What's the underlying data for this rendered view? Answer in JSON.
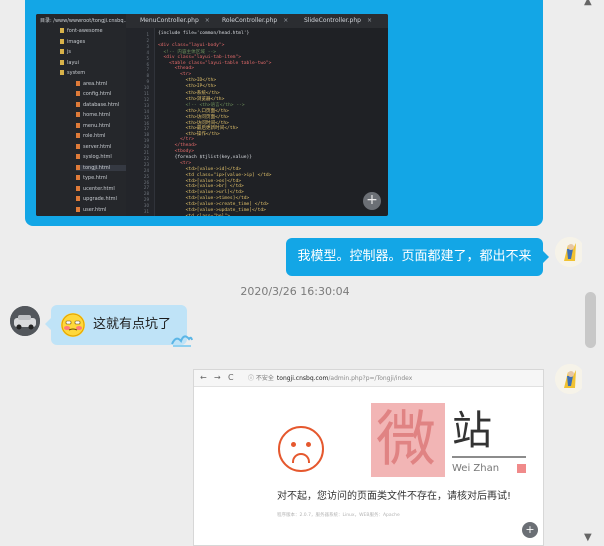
{
  "ide": {
    "path_label": "目录: /www/wwwroot/tongji.cnsbq...",
    "folders": [
      {
        "label": "font-awesome",
        "open": false
      },
      {
        "label": "images",
        "open": false
      },
      {
        "label": "js",
        "open": false
      },
      {
        "label": "layui",
        "open": false
      },
      {
        "label": "system",
        "open": true
      }
    ],
    "files": [
      "area.html",
      "config.html",
      "database.html",
      "home.html",
      "menu.html",
      "role.html",
      "server.html",
      "syslog.html",
      "tongji.html",
      "type.html",
      "ucenter.html",
      "upgrade.html",
      "user.html"
    ],
    "selected_file": "tongji.html",
    "tabs": [
      "MenuController.php",
      "RoleController.php",
      "SlideController.php"
    ],
    "tab_close": "×",
    "line_numbers": [
      "1",
      "2",
      "3",
      "4",
      "5",
      "6",
      "7",
      "8",
      "9",
      "10",
      "11",
      "12",
      "13",
      "14",
      "15",
      "16",
      "17",
      "18",
      "19",
      "20",
      "21",
      "22",
      "23",
      "24",
      "25",
      "26",
      "27",
      "28",
      "29",
      "30",
      "31"
    ],
    "code_lines": [
      "{include file='common/head.html'}",
      "",
      "<div class=\"layui-body\">",
      "  <!-- 内容主体区域 -->",
      "  <div class=\"layui-tab-item\">",
      "    <table class=\"layui-table table-two\">",
      "      <thead>",
      "        <tr>",
      "          <th>ID</th>",
      "          <th>IP</th>",
      "          <th>系统</th>",
      "          <th>浏览器</th>",
      "          <!-- <th>语言</th> -->",
      "          <th>入口页面</th>",
      "          <th>访问页面</th>",
      "          <th>访问时间</th>",
      "          <th>最后更新时间</th>",
      "          <th>操作</th>",
      "        </tr>",
      "      </thead>",
      "      <tbody>",
      "      {foreach $tjlist(key,value)}",
      "        <tr>",
      "          <td>[value->id]</td>",
      "          <td class=\"ip>[value->ip] </td>",
      "          <td>[value->os]</td>",
      "          <td>[value->br] </td>",
      "          <td>[value->url]</td>",
      "          <td>[value->times]</td>",
      "          <td>[value->create_time] </td>",
      "          <td>[value->update_time]</td>"
    ],
    "code_line_32": "          <td class=\"hel\">",
    "plus_label": "+"
  },
  "messages": {
    "outgoing_text": "我模型。控制器。页面都建了，都出不来",
    "timestamp": "2020/3/26 16:30:04",
    "incoming_text": "这就有点坑了"
  },
  "browser": {
    "nav_back": "←",
    "nav_forward": "→",
    "nav_reload": "C",
    "security_label": "ⓘ 不安全",
    "url_host": "tongji.cnsbq.com",
    "url_rest": "/admin.php?p=/Tongji/index",
    "error_text": "对不起，您访问的页面类文件不存在，请核对后再试!",
    "footer_text": "程序版本：2.0.7，服务器系统：Linux，WEB服务：Apache",
    "watermark_char1": "微",
    "watermark_char2": "站",
    "watermark_sub": "Wei Zhan",
    "zoom_label": "+"
  },
  "scroll": {
    "up": "▲",
    "down": "▼"
  },
  "colors": {
    "accent": "#13a6e6",
    "incoming_bubble": "#bfe3f7",
    "error": "#e5582e",
    "background": "#ededed"
  }
}
